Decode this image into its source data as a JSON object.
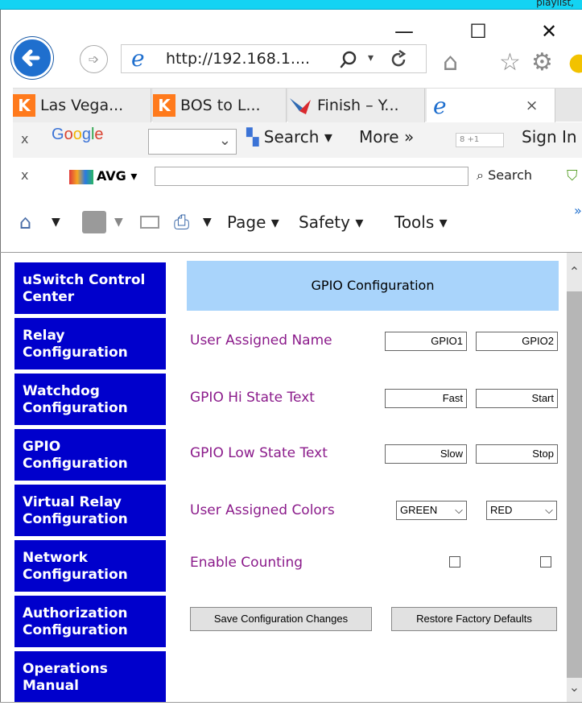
{
  "top_strip": {
    "text": "playlist,"
  },
  "window": {
    "minimize": "—",
    "maximize": "☐",
    "close": "✕"
  },
  "address": {
    "url": "http://192.168.1....",
    "search_icon": "search-icon",
    "refresh_icon": "refresh-icon"
  },
  "tabs": [
    {
      "label": "Las Vega...",
      "favicon": "K",
      "close": ""
    },
    {
      "label": "BOS to L...",
      "favicon": "K",
      "close": ""
    },
    {
      "label": "Finish – Y...",
      "favicon": "",
      "close": ""
    },
    {
      "label": "",
      "favicon": "e",
      "close": "×"
    }
  ],
  "google_bar": {
    "close": "x",
    "logo": "Google",
    "search_label": "Search ▾",
    "more_label": "More »",
    "plus_one": "8 +1",
    "sign_in": "Sign In"
  },
  "avg_bar": {
    "close": "x",
    "brand": "AVG ▾",
    "search_label": "Search"
  },
  "command_bar": {
    "page": "Page ▾",
    "safety": "Safety ▾",
    "tools": "Tools ▾",
    "chevron": "»"
  },
  "sidebar": {
    "items": [
      {
        "label": "uSwitch Control Center"
      },
      {
        "label": "Relay Configuration"
      },
      {
        "label": "Watchdog Configuration"
      },
      {
        "label": "GPIO Configuration"
      },
      {
        "label": "Virtual Relay Configuration"
      },
      {
        "label": "Network Configuration"
      },
      {
        "label": "Authorization Configuration"
      },
      {
        "label": "Operations Manual"
      }
    ]
  },
  "gpio": {
    "header": "GPIO Configuration",
    "rows": {
      "name_label": "User Assigned Name",
      "hi_label": "GPIO Hi State Text",
      "low_label": "GPIO Low State Text",
      "colors_label": "User Assigned Colors",
      "counting_label": "Enable Counting"
    },
    "values": {
      "name1": "GPIO1",
      "name2": "GPIO2",
      "hi1": "Fast",
      "hi2": "Start",
      "low1": "Slow",
      "low2": "Stop",
      "color1": "GREEN",
      "color2": "RED"
    },
    "save_button": "Save Configuration Changes",
    "restore_button": "Restore Factory Defaults"
  }
}
